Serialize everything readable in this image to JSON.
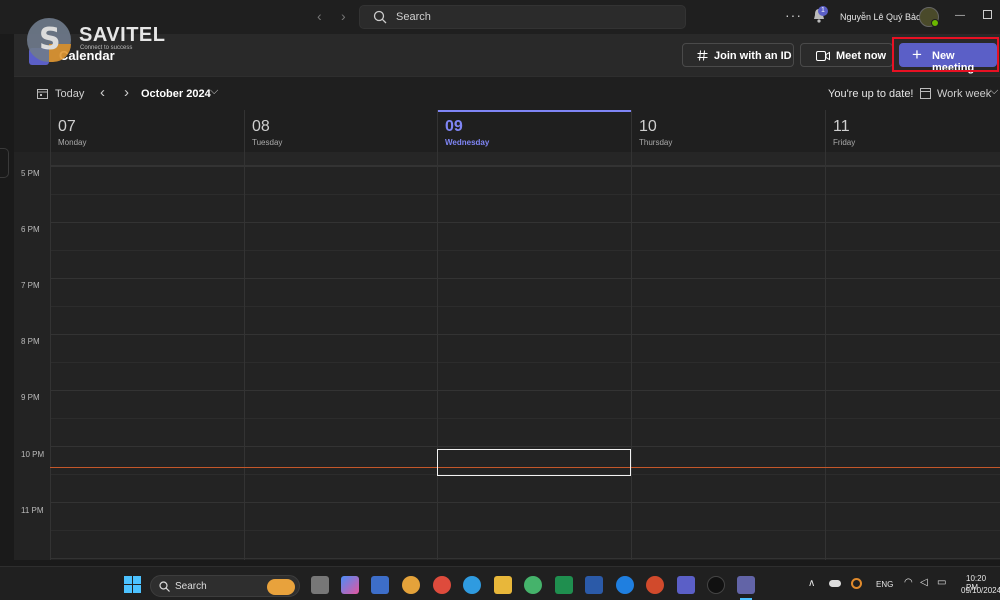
{
  "titlebar": {
    "search_placeholder": "Search",
    "notification_count": "1",
    "user_name": "Nguyễn Lê Quý Bảo"
  },
  "watermark": {
    "brand": "SAVITEL",
    "slogan": "Connect to success"
  },
  "header": {
    "title": "Calendar",
    "join_label": "Join with an ID",
    "meet_label": "Meet now",
    "new_meeting_label": "New meeting"
  },
  "toolbar": {
    "today_label": "Today",
    "month_label": "October 2024",
    "status_text": "You're up to date!",
    "view_label": "Work week"
  },
  "days": [
    {
      "num": "07",
      "name": "Monday"
    },
    {
      "num": "08",
      "name": "Tuesday"
    },
    {
      "num": "09",
      "name": "Wednesday"
    },
    {
      "num": "10",
      "name": "Thursday"
    },
    {
      "num": "11",
      "name": "Friday"
    }
  ],
  "times": [
    "5 PM",
    "6 PM",
    "7 PM",
    "8 PM",
    "9 PM",
    "10 PM",
    "11 PM"
  ],
  "taskbar": {
    "search_label": "Search",
    "lang": "ENG",
    "clock_time": "10:20 PM",
    "clock_date": "09/10/2024"
  },
  "colors": {
    "accent": "#5b5fc7",
    "today": "#7f85f5",
    "now_line": "#c4572a",
    "highlight": "#e81123"
  }
}
